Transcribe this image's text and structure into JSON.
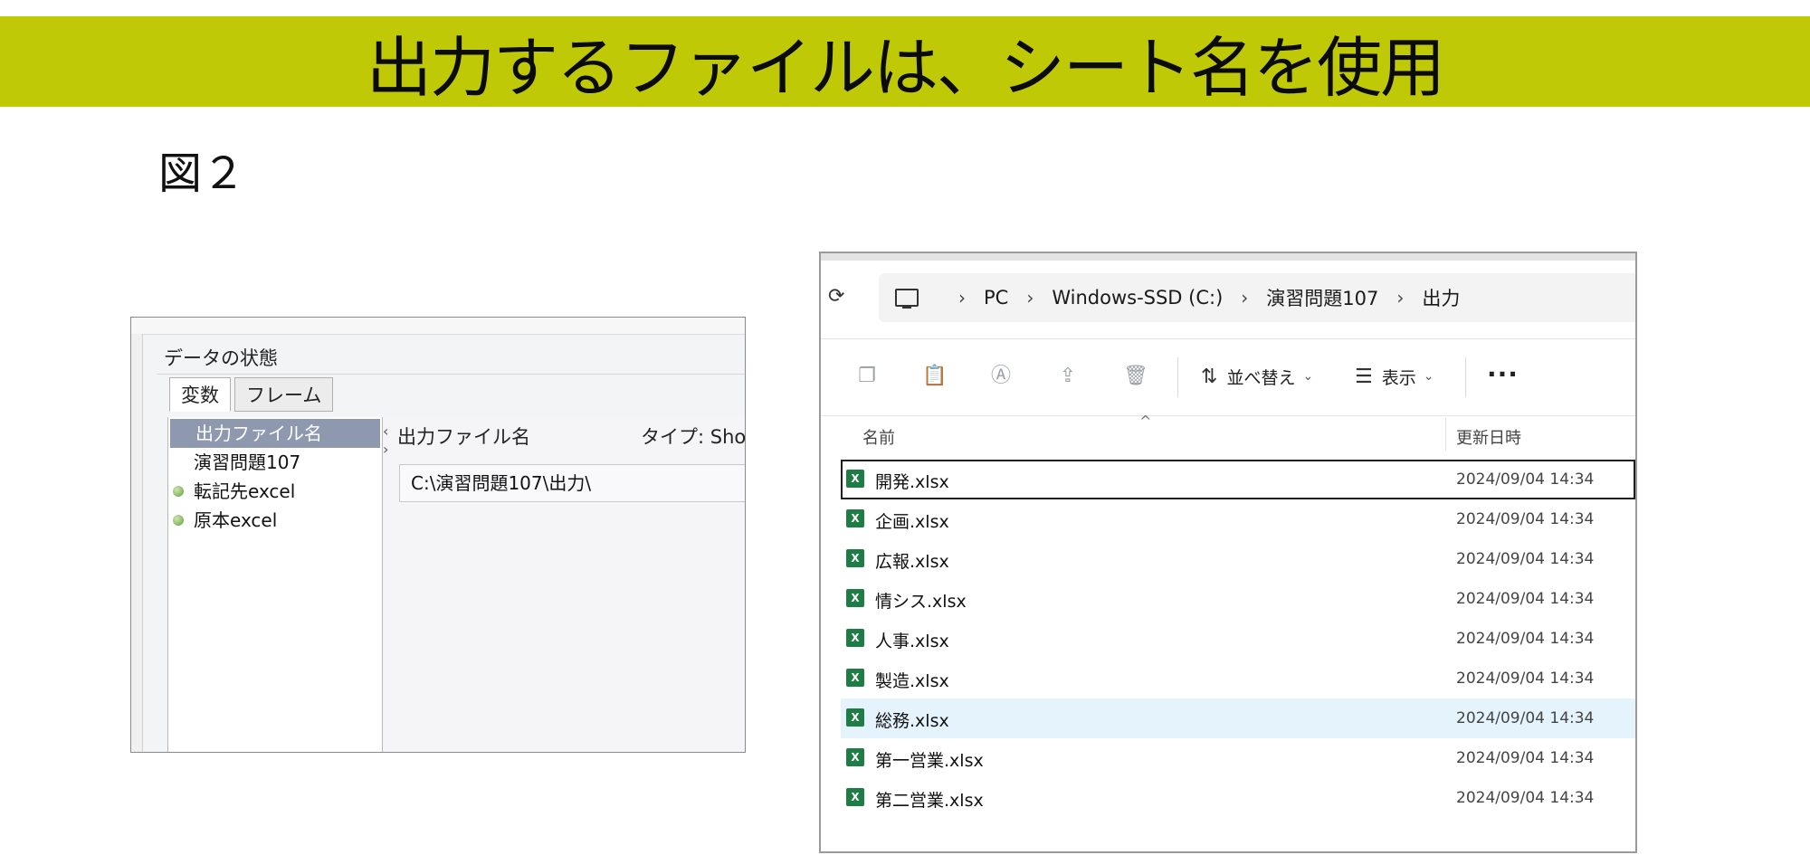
{
  "slide": {
    "title": "出力するファイルは、シート名を使用",
    "figure_label": "図２"
  },
  "variable_panel": {
    "state_label": "データの状態",
    "tabs": [
      {
        "label": "変数",
        "active": true
      },
      {
        "label": "フレーム",
        "active": false
      }
    ],
    "items": [
      {
        "label": "出力ファイル名",
        "selected": true,
        "dot": false
      },
      {
        "label": "演習問題107",
        "selected": false,
        "dot": false
      },
      {
        "label": "転記先excel",
        "selected": false,
        "dot": true
      },
      {
        "label": "原本excel",
        "selected": false,
        "dot": true
      }
    ],
    "detail_name": "出力ファイル名",
    "detail_type": "タイプ: Shor",
    "value": "C:\\演習問題107\\出力\\"
  },
  "explorer": {
    "breadcrumb": [
      "PC",
      "Windows-SSD (C:)",
      "演習問題107",
      "出力"
    ],
    "toolbar": {
      "sort_label": "並べ替え",
      "view_label": "表示",
      "more_label": "···"
    },
    "columns": {
      "name": "名前",
      "date": "更新日時"
    },
    "files": [
      {
        "name": "開発.xlsx",
        "date": "2024/09/04 14:34",
        "state": "focused"
      },
      {
        "name": "企画.xlsx",
        "date": "2024/09/04 14:34",
        "state": ""
      },
      {
        "name": "広報.xlsx",
        "date": "2024/09/04 14:34",
        "state": ""
      },
      {
        "name": "情シス.xlsx",
        "date": "2024/09/04 14:34",
        "state": ""
      },
      {
        "name": "人事.xlsx",
        "date": "2024/09/04 14:34",
        "state": ""
      },
      {
        "name": "製造.xlsx",
        "date": "2024/09/04 14:34",
        "state": ""
      },
      {
        "name": "総務.xlsx",
        "date": "2024/09/04 14:34",
        "state": "hover"
      },
      {
        "name": "第一営業.xlsx",
        "date": "2024/09/04 14:34",
        "state": ""
      },
      {
        "name": "第二営業.xlsx",
        "date": "2024/09/04 14:34",
        "state": ""
      }
    ],
    "colors": {
      "hover_bg": "#e5f3fd",
      "excel_green": "#1e7d45"
    }
  },
  "colors": {
    "banner": "#bfc906",
    "selected_item": "#8e99b0"
  }
}
